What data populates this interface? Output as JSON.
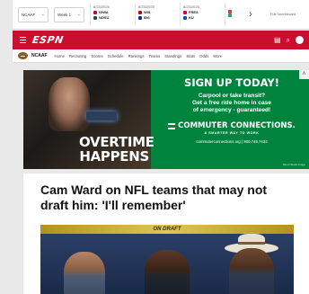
{
  "scores": {
    "league_select": "NCAAF",
    "week_select": "Week 1",
    "games": [
      {
        "date": "8/23/2025",
        "team1": "IOWA",
        "team2": "NDSU",
        "color1": "#b0122b",
        "color2": "#1f5a2f"
      },
      {
        "date": "8/23/2025",
        "team1": "WIS",
        "team2": "IDS",
        "color1": "#c5050c",
        "color2": "#0033a0"
      },
      {
        "date": "8/23/2025",
        "team1": "FRES",
        "team2": "KU",
        "color1": "#db0032",
        "color2": "#0051ba"
      },
      {
        "date": "8/23/2025",
        "team1": "",
        "team2": "",
        "color1": "#c44",
        "color2": "#2a5"
      }
    ],
    "full_scoreboard": "Full Scoreboard"
  },
  "header": {
    "logo": "ESPN"
  },
  "subnav": {
    "league": "NCAAF",
    "links": [
      "Home",
      "Recruiting",
      "Scores",
      "Schedule",
      "Rankings",
      "Teams",
      "Standings",
      "Stats",
      "Odds",
      "More"
    ]
  },
  "ad": {
    "headline_left_1": "OVERTIME",
    "headline_left_2": "HAPPENS",
    "headline_right": "SIGN UP TODAY!",
    "sub_line_1": "Carpool or take transit?",
    "sub_line_2": "Get a free ride home in case",
    "sub_line_3": "of emergency - guaranteed!",
    "brand": "COMMUTER CONNECTIONS.",
    "tagline": "A SMARTER WAY TO WORK",
    "url": "commuterconnections.org | 800.745.7433",
    "credit": "Metro Stock Image"
  },
  "article": {
    "headline": "Cam Ward on NFL teams that may not draft him: 'I'll remember'",
    "video_banner": "ON DRAFT"
  },
  "colors": {
    "espn_red": "#c8102e",
    "ad_green": "#00843d"
  }
}
